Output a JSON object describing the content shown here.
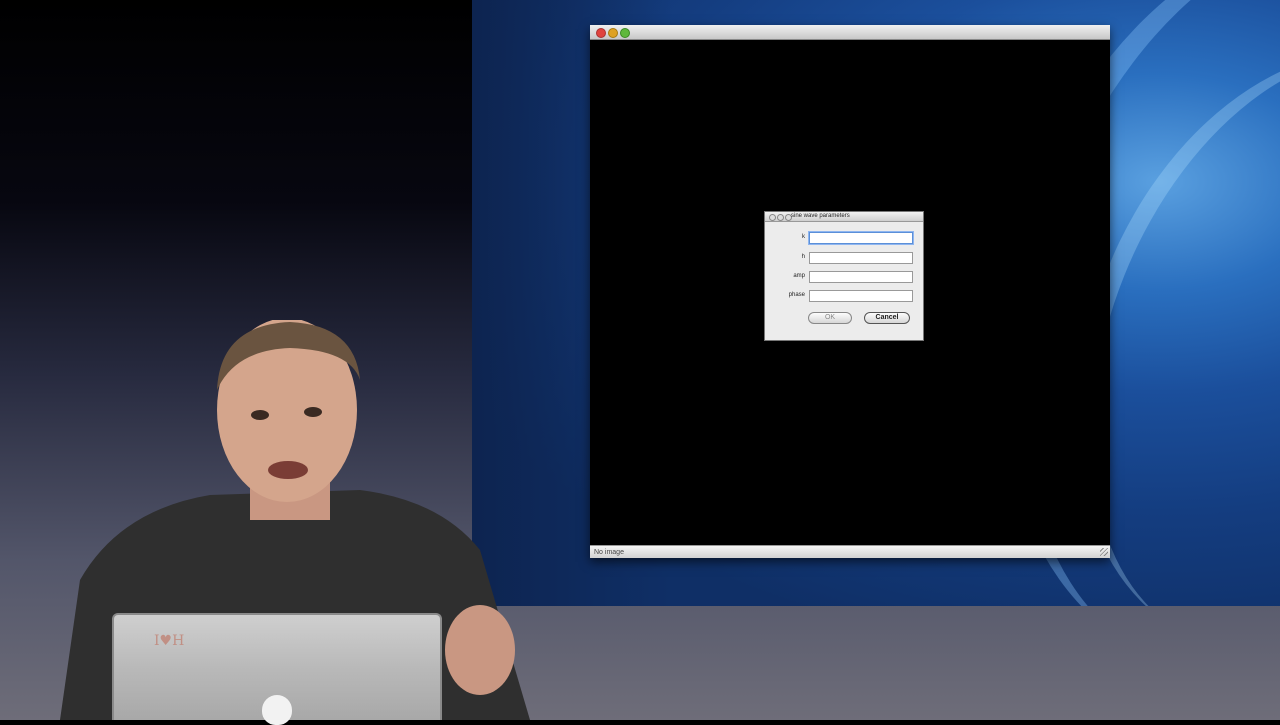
{
  "app_window": {
    "status_text": "No image"
  },
  "dialog": {
    "title": "sine wave parameters",
    "fields": [
      {
        "label": "k",
        "value": ""
      },
      {
        "label": "h",
        "value": ""
      },
      {
        "label": "amp",
        "value": ""
      },
      {
        "label": "phase",
        "value": ""
      }
    ],
    "ok_label": "OK",
    "cancel_label": "Cancel"
  },
  "scene": {
    "laptop_sticker": "I♥H"
  },
  "colors": {
    "desktop_blue": "#1b4f9c",
    "window_bg": "#000000",
    "focus_ring": "#5b8fd8"
  }
}
